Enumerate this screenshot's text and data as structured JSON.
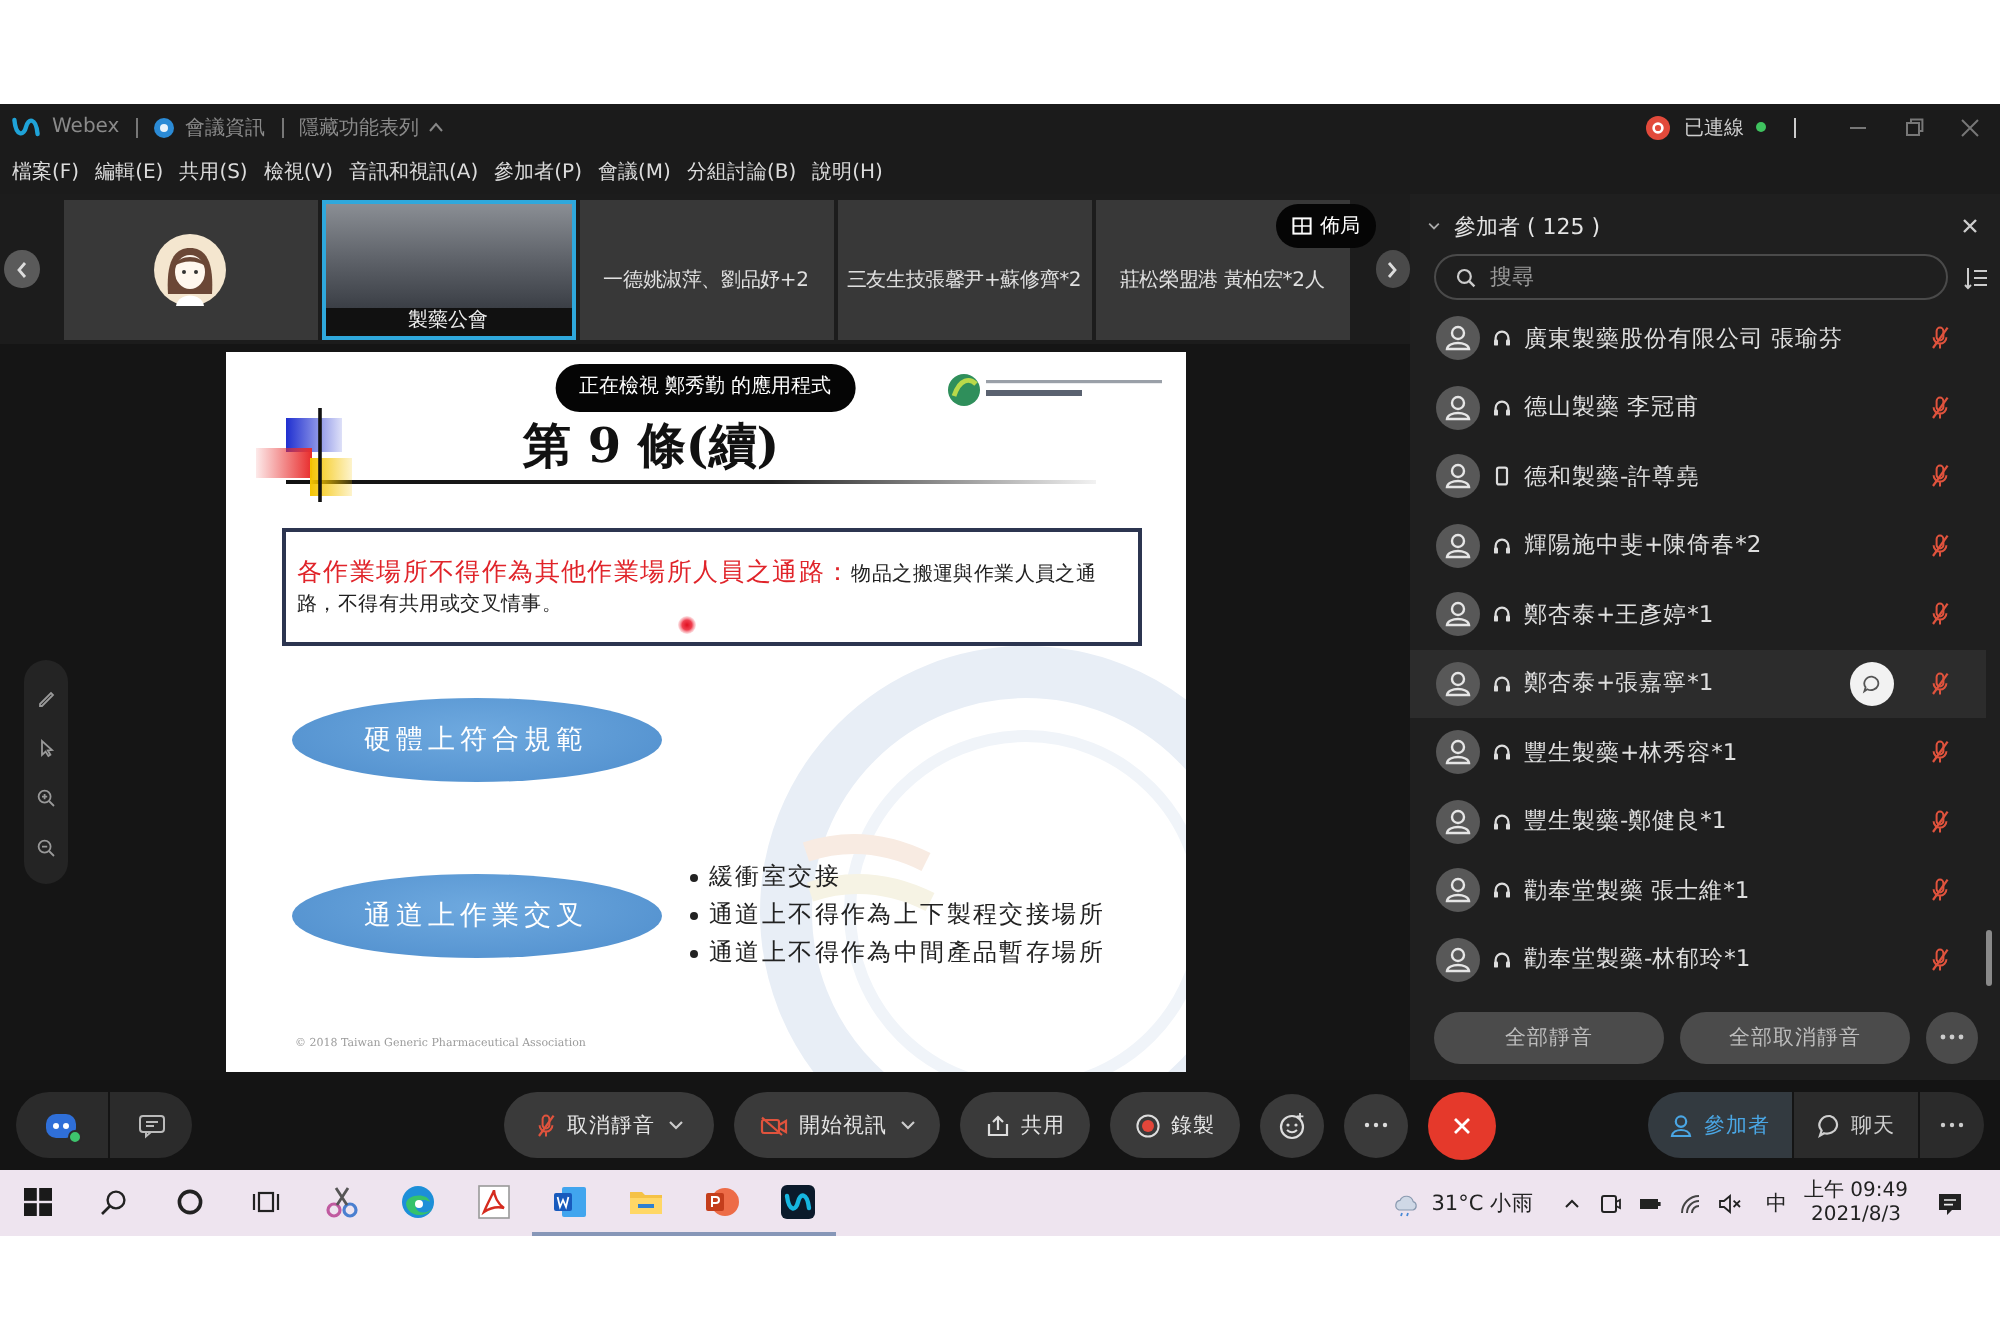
{
  "title_bar": {
    "app_name": "Webex",
    "meeting_info": "會議資訊",
    "hide_menu": "隱藏功能表列",
    "status": "已連線"
  },
  "menu_bar": {
    "items": [
      "檔案(F)",
      "編輯(E)",
      "共用(S)",
      "檢視(V)",
      "音訊和視訊(A)",
      "參加者(P)",
      "會議(M)",
      "分組討論(B)",
      "說明(H)"
    ]
  },
  "video_strip": {
    "tiles": [
      {
        "kind": "avatar",
        "active": false
      },
      {
        "kind": "video",
        "label": "製藥公會",
        "active": true
      },
      {
        "kind": "name",
        "label": "一德姚淑萍、劉品妤+2",
        "active": false
      },
      {
        "kind": "name",
        "label": "三友生技張馨尹+蘇修齊*2",
        "active": false
      },
      {
        "kind": "name",
        "label": "莊松榮盟港 黃柏宏*2人",
        "active": false
      }
    ],
    "layout_button": "佈局"
  },
  "stage": {
    "sharing_banner": "正在檢視 鄭秀勤 的應用程式",
    "slide": {
      "title": "第 9 條(續)",
      "rule_text": "**各作業場所不得作為其他作業場所人員之通路：**物品之搬運與作業人員之通路，不得有共用或交叉情事。",
      "topics": [
        {
          "label": "硬體上符合規範"
        },
        {
          "label": "通道上作業交叉",
          "bullets": [
            "緩衝室交接",
            "通道上不得作為上下製程交接場所",
            "通道上不得作為中間產品暫存場所"
          ]
        }
      ],
      "footer": "© 2018 Taiwan Generic Pharmaceutical Association"
    }
  },
  "participants_panel": {
    "title": "參加者 ( 125 )",
    "search": {
      "placeholder": "搜尋"
    },
    "participants": [
      {
        "name": "廣東製藥股份有限公司 張瑜芬",
        "kind": "headset",
        "muted": true,
        "hovered": false
      },
      {
        "name": "德山製藥 李冠甫",
        "kind": "headset",
        "muted": true,
        "hovered": false
      },
      {
        "name": "德和製藥-許尊堯",
        "kind": "phone",
        "muted": true,
        "hovered": false
      },
      {
        "name": "輝陽施中斐+陳倚春*2",
        "kind": "headset",
        "muted": true,
        "hovered": false
      },
      {
        "name": "鄭杏泰+王彥婷*1",
        "kind": "headset",
        "muted": true,
        "hovered": false
      },
      {
        "name": "鄭杏泰+張嘉寧*1",
        "kind": "headset",
        "muted": true,
        "hovered": true
      },
      {
        "name": "豐生製藥+林秀容*1",
        "kind": "headset",
        "muted": true,
        "hovered": false
      },
      {
        "name": "豐生製藥-鄭健良*1",
        "kind": "headset",
        "muted": true,
        "hovered": false
      },
      {
        "name": "勸奉堂製藥 張士維*1",
        "kind": "headset",
        "muted": true,
        "hovered": false
      },
      {
        "name": "勸奉堂製藥-林郁玲*1",
        "kind": "headset",
        "muted": true,
        "hovered": false
      }
    ],
    "buttons": [
      "全部靜音",
      "全部取消靜音"
    ]
  },
  "controls": {
    "center": [
      {
        "kind": "audio",
        "label": "取消靜音",
        "muted": true
      },
      {
        "kind": "video",
        "label": "開始視訊",
        "stopped": true
      },
      {
        "kind": "share",
        "label": "共用"
      },
      {
        "kind": "record",
        "label": "錄製"
      },
      {
        "kind": "reactions"
      },
      {
        "kind": "more"
      },
      {
        "kind": "end"
      }
    ],
    "right": [
      {
        "kind": "participants",
        "label": "參加者",
        "selected": true
      },
      {
        "kind": "chat",
        "label": "聊天",
        "selected": false
      }
    ]
  },
  "taskbar": {
    "apps": [
      {
        "kind": "snipping",
        "running": false
      },
      {
        "kind": "edge",
        "running": false
      },
      {
        "kind": "acrobat",
        "running": false
      },
      {
        "kind": "word",
        "running": true
      },
      {
        "kind": "explorer",
        "running": true
      },
      {
        "kind": "powerpoint",
        "running": true
      },
      {
        "kind": "webex",
        "running": true
      }
    ],
    "weather": "31°C 小雨",
    "input_method": "中",
    "time": "上午 09:49",
    "date": "2021/8/3"
  }
}
